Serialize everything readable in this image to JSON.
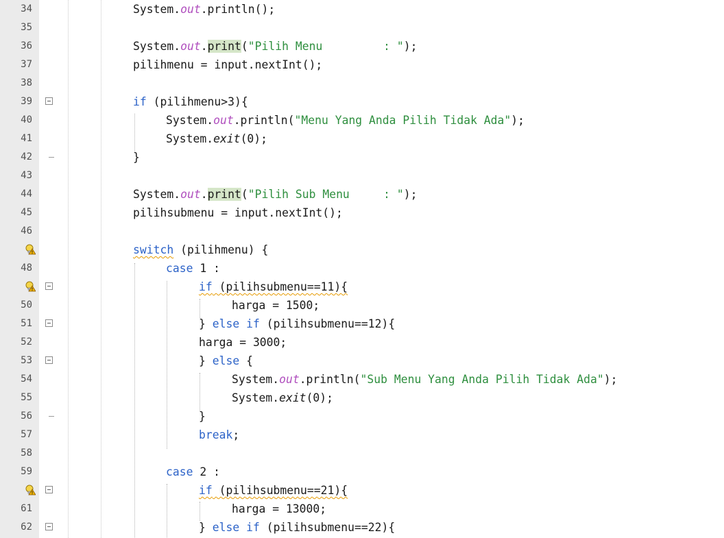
{
  "editor": {
    "lines": [
      {
        "n": "34",
        "indent": 1,
        "fold": "",
        "bulb": false,
        "tokens": [
          {
            "t": "System."
          },
          {
            "t": "out",
            "c": "fld"
          },
          {
            "t": ".println();"
          }
        ]
      },
      {
        "n": "35",
        "indent": 1,
        "fold": "",
        "bulb": false,
        "tokens": []
      },
      {
        "n": "36",
        "indent": 1,
        "fold": "",
        "bulb": false,
        "tokens": [
          {
            "t": "System."
          },
          {
            "t": "out",
            "c": "fld"
          },
          {
            "t": "."
          },
          {
            "t": "print",
            "c": "hl"
          },
          {
            "t": "("
          },
          {
            "t": "\"Pilih Menu         : \"",
            "c": "str"
          },
          {
            "t": ");"
          }
        ]
      },
      {
        "n": "37",
        "indent": 1,
        "fold": "",
        "bulb": false,
        "tokens": [
          {
            "t": "pilihmenu = input.nextInt();"
          }
        ]
      },
      {
        "n": "38",
        "indent": 1,
        "fold": "",
        "bulb": false,
        "tokens": []
      },
      {
        "n": "39",
        "indent": 1,
        "fold": "box",
        "bulb": false,
        "tokens": [
          {
            "t": "if",
            "c": "kw"
          },
          {
            "t": " (pilihmenu>3){"
          }
        ]
      },
      {
        "n": "40",
        "indent": 2,
        "fold": "",
        "bulb": false,
        "tokens": [
          {
            "t": "System."
          },
          {
            "t": "out",
            "c": "fld"
          },
          {
            "t": ".println("
          },
          {
            "t": "\"Menu Yang Anda Pilih Tidak Ada\"",
            "c": "str"
          },
          {
            "t": ");"
          }
        ]
      },
      {
        "n": "41",
        "indent": 2,
        "fold": "",
        "bulb": false,
        "tokens": [
          {
            "t": "System."
          },
          {
            "t": "exit",
            "c": "it"
          },
          {
            "t": "(0);"
          }
        ]
      },
      {
        "n": "42",
        "indent": 1,
        "fold": "end",
        "bulb": false,
        "tokens": [
          {
            "t": "}"
          }
        ]
      },
      {
        "n": "43",
        "indent": 1,
        "fold": "",
        "bulb": false,
        "tokens": []
      },
      {
        "n": "44",
        "indent": 1,
        "fold": "",
        "bulb": false,
        "tokens": [
          {
            "t": "System."
          },
          {
            "t": "out",
            "c": "fld"
          },
          {
            "t": "."
          },
          {
            "t": "print",
            "c": "hl"
          },
          {
            "t": "("
          },
          {
            "t": "\"Pilih Sub Menu     : \"",
            "c": "str"
          },
          {
            "t": ");"
          }
        ]
      },
      {
        "n": "45",
        "indent": 1,
        "fold": "",
        "bulb": false,
        "tokens": [
          {
            "t": "pilihsubmenu = input.nextInt();"
          }
        ]
      },
      {
        "n": "46",
        "indent": 1,
        "fold": "",
        "bulb": false,
        "tokens": []
      },
      {
        "n": "",
        "indent": 1,
        "fold": "",
        "bulb": true,
        "tokens": [
          {
            "t": "switch",
            "c": "kw warn"
          },
          {
            "t": " (pilihmenu) {"
          }
        ]
      },
      {
        "n": "48",
        "indent": 2,
        "fold": "",
        "bulb": false,
        "tokens": [
          {
            "t": "case",
            "c": "kw"
          },
          {
            "t": " 1 :"
          }
        ]
      },
      {
        "n": "",
        "indent": 3,
        "fold": "box",
        "bulb": true,
        "tokens": [
          {
            "t": "if",
            "c": "kw warn"
          },
          {
            "t": " (pilihsubmenu==11){",
            "c": "warn"
          }
        ]
      },
      {
        "n": "50",
        "indent": 4,
        "fold": "",
        "bulb": false,
        "tokens": [
          {
            "t": "harga = 1500;"
          }
        ]
      },
      {
        "n": "51",
        "indent": 3,
        "fold": "box",
        "bulb": false,
        "tokens": [
          {
            "t": "} "
          },
          {
            "t": "else if",
            "c": "kw"
          },
          {
            "t": " (pilihsubmenu==12){"
          }
        ]
      },
      {
        "n": "52",
        "indent": 3,
        "fold": "",
        "bulb": false,
        "tokens": [
          {
            "t": "harga = 3000;"
          }
        ]
      },
      {
        "n": "53",
        "indent": 3,
        "fold": "box",
        "bulb": false,
        "tokens": [
          {
            "t": "} "
          },
          {
            "t": "else",
            "c": "kw"
          },
          {
            "t": " {"
          }
        ]
      },
      {
        "n": "54",
        "indent": 4,
        "fold": "",
        "bulb": false,
        "tokens": [
          {
            "t": "System."
          },
          {
            "t": "out",
            "c": "fld"
          },
          {
            "t": ".println("
          },
          {
            "t": "\"Sub Menu Yang Anda Pilih Tidak Ada\"",
            "c": "str"
          },
          {
            "t": ");"
          }
        ]
      },
      {
        "n": "55",
        "indent": 4,
        "fold": "",
        "bulb": false,
        "tokens": [
          {
            "t": "System."
          },
          {
            "t": "exit",
            "c": "it"
          },
          {
            "t": "(0);"
          }
        ]
      },
      {
        "n": "56",
        "indent": 3,
        "fold": "end",
        "bulb": false,
        "tokens": [
          {
            "t": "}"
          }
        ]
      },
      {
        "n": "57",
        "indent": 3,
        "fold": "",
        "bulb": false,
        "tokens": [
          {
            "t": "break",
            "c": "kw"
          },
          {
            "t": ";"
          }
        ]
      },
      {
        "n": "58",
        "indent": 2,
        "fold": "",
        "bulb": false,
        "tokens": []
      },
      {
        "n": "59",
        "indent": 2,
        "fold": "",
        "bulb": false,
        "tokens": [
          {
            "t": "case",
            "c": "kw"
          },
          {
            "t": " 2 :"
          }
        ]
      },
      {
        "n": "",
        "indent": 3,
        "fold": "box",
        "bulb": true,
        "tokens": [
          {
            "t": "if",
            "c": "kw warn"
          },
          {
            "t": " (pilihsubmenu==21){",
            "c": "warn"
          }
        ]
      },
      {
        "n": "61",
        "indent": 4,
        "fold": "",
        "bulb": false,
        "tokens": [
          {
            "t": "harga = 13000;"
          }
        ]
      },
      {
        "n": "62",
        "indent": 3,
        "fold": "box",
        "bulb": false,
        "tokens": [
          {
            "t": "} "
          },
          {
            "t": "else if",
            "c": "kw"
          },
          {
            "t": " (pilihsubmenu==22){"
          }
        ]
      }
    ]
  },
  "colors": {
    "keyword": "#2d63c8",
    "field": "#b04fbe",
    "string": "#2f8f3f",
    "highlight": "#d5e6c8",
    "warning": "#e69a00",
    "gutter": "#ebebeb"
  },
  "icons": {
    "hint": "warning-lightbulb-icon",
    "fold": "fold-collapse-icon"
  }
}
